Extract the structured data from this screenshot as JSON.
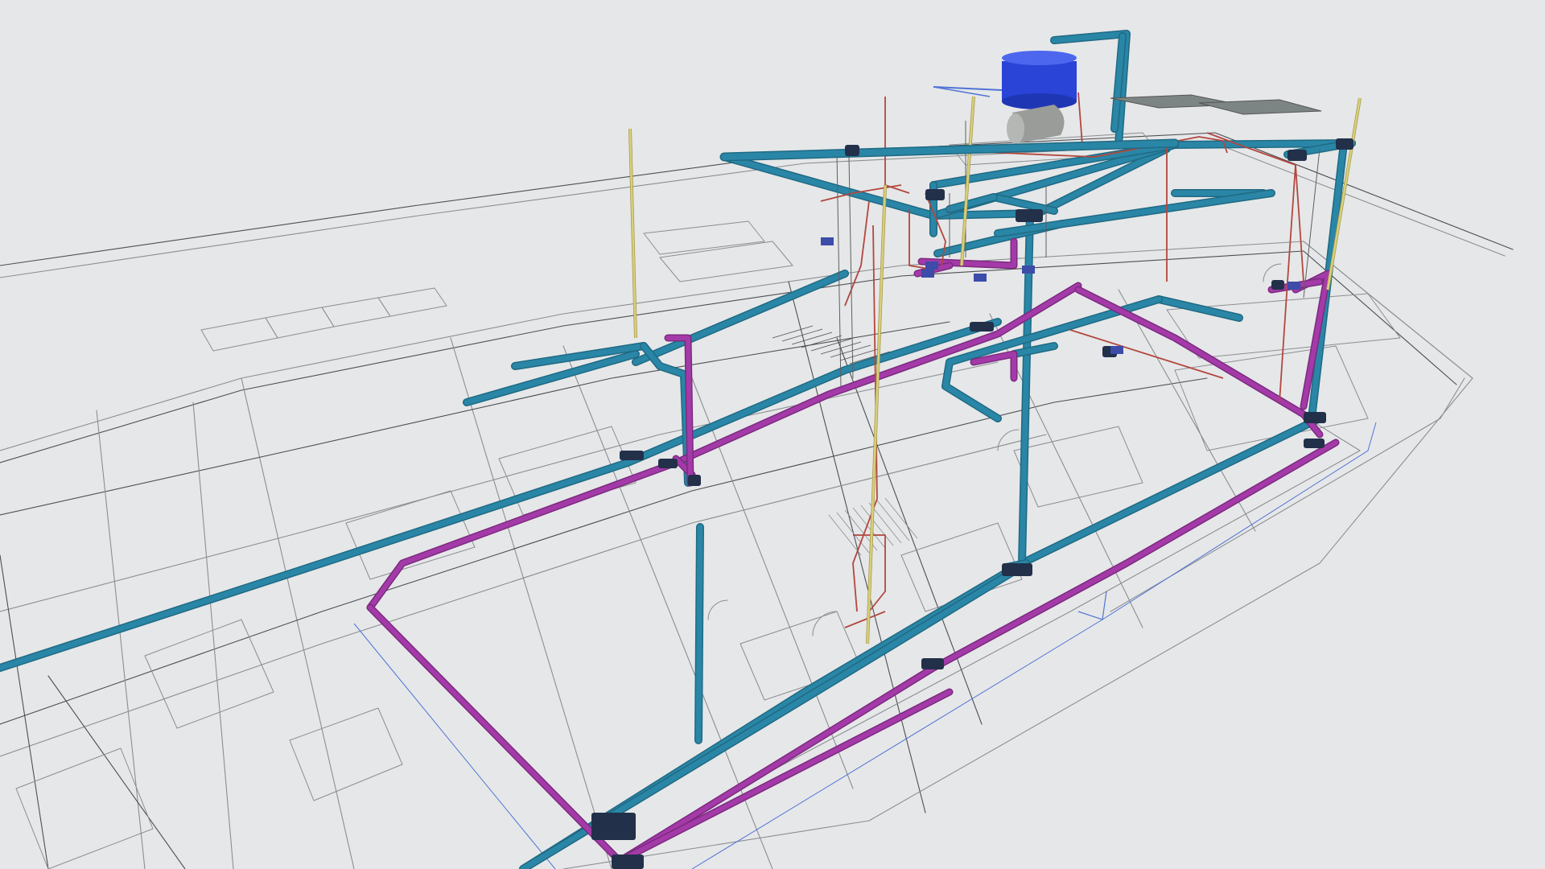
{
  "viewer": {
    "background": "#e6e7e8"
  },
  "colors": {
    "plan_lines": "#4c4f52",
    "plan_lines_light": "#8b8e91",
    "cold_water_pipe": "#2a86a6",
    "cold_water_pipe_shade": "#1f6a84",
    "sewer_pipe": "#a43aa8",
    "sewer_pipe_shade": "#7b2a80",
    "hot_water_pipe": "#b2473f",
    "vent_pipe": "#d9cf7a",
    "gas_line": "#4f74d6",
    "fitting_box": "#22304a",
    "water_tank": "#2a44d8",
    "water_tank_top": "#4d66ee",
    "heater_tank": "#9a9c9a",
    "solar_panel": "#7d8584"
  },
  "icons": {
    "water_tank": "cylinder-tank-icon",
    "heater": "horizontal-tank-icon",
    "solar_panel": "solar-panel-icon",
    "fitting": "pipe-fitting-icon"
  }
}
